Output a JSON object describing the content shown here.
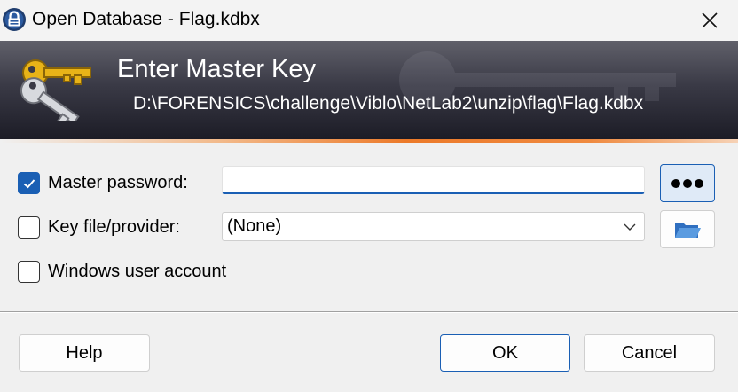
{
  "window": {
    "title": "Open Database - Flag.kdbx",
    "app_icon": "keepass-lock-icon",
    "close_icon": "close-icon"
  },
  "banner": {
    "title": "Enter Master Key",
    "path": "D:\\FORENSICS\\challenge\\Viblo\\NetLab2\\unzip\\flag\\Flag.kdbx",
    "icon": "keys-icon"
  },
  "master_password": {
    "label": "Master password:",
    "checked": true,
    "value": "",
    "toggle_icon": "show-password-dots-icon"
  },
  "key_file": {
    "label": "Key file/provider:",
    "checked": false,
    "selected": "(None)",
    "browse_icon": "folder-open-icon"
  },
  "windows_account": {
    "label": "Windows user account",
    "checked": false
  },
  "buttons": {
    "help": "Help",
    "ok": "OK",
    "cancel": "Cancel"
  },
  "colors": {
    "accent": "#1a5fb4",
    "banner_dark": "#1c1c26",
    "banner_line": "#ec7a2a"
  }
}
